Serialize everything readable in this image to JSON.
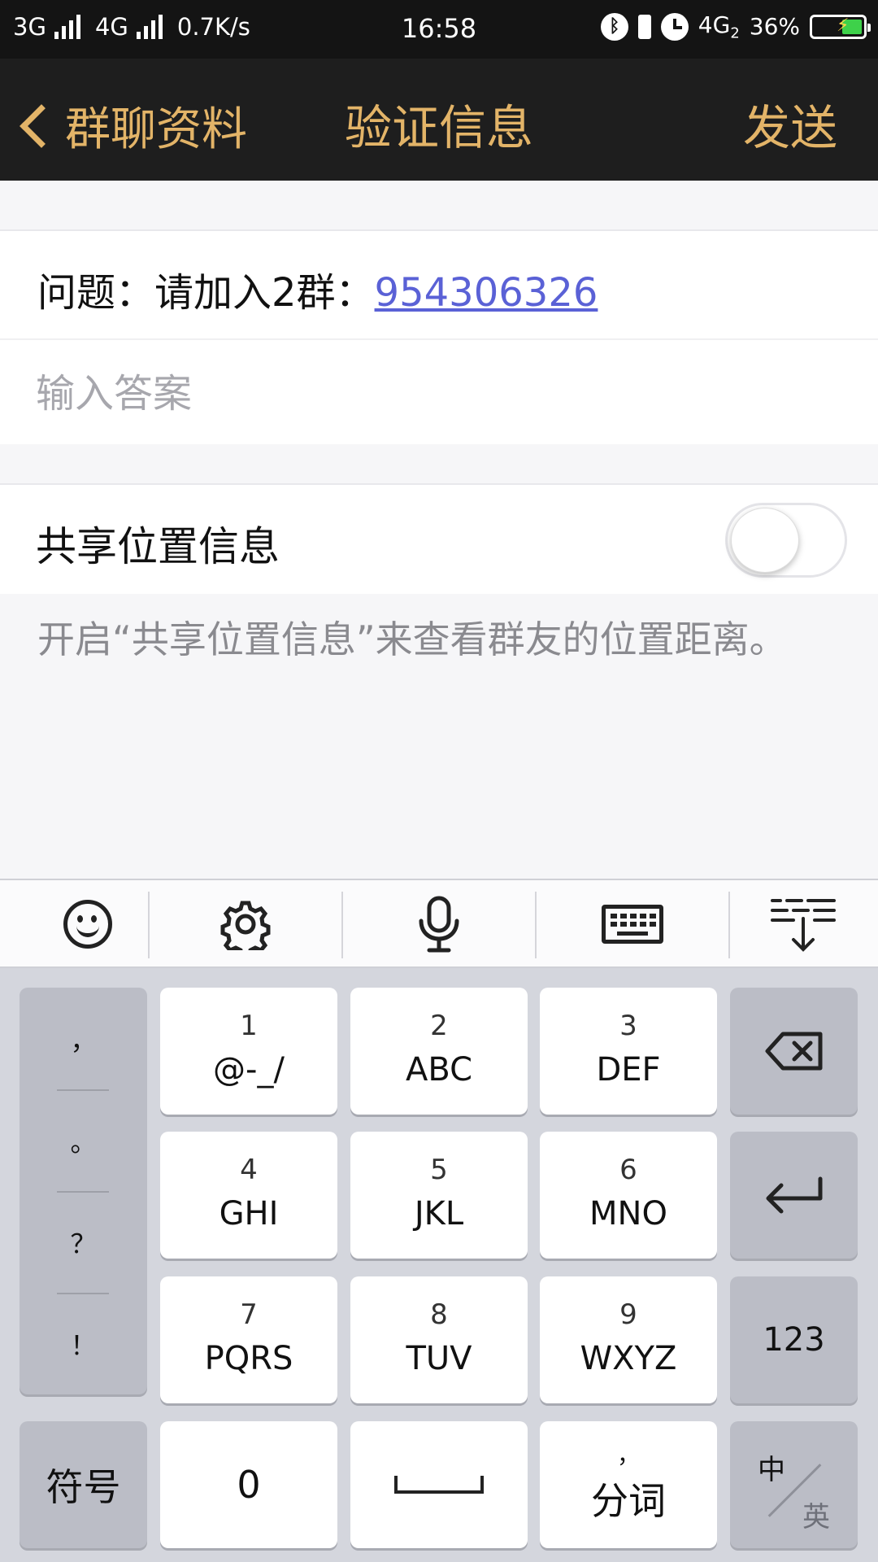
{
  "status_bar": {
    "net1": "3G",
    "net2": "4G",
    "speed": "0.7K/s",
    "time": "16:58",
    "net3": "4G",
    "net3_sub": "2",
    "battery": "36%"
  },
  "nav": {
    "back_label": "群聊资料",
    "title": "验证信息",
    "send_label": "发送"
  },
  "question": {
    "prefix": "问题：请加入2群：",
    "number": "954306326"
  },
  "answer": {
    "placeholder": "输入答案",
    "value": ""
  },
  "location": {
    "label": "共享位置信息",
    "enabled": false,
    "hint": "开启“共享位置信息”来查看群友的位置距离。"
  },
  "keyboard": {
    "toolbar": [
      "emoji-icon",
      "gear-icon",
      "microphone-icon",
      "keyboard-icon",
      "collapse-keyboard-icon"
    ],
    "punctuation": [
      "，",
      "。",
      "？",
      "！"
    ],
    "keys": [
      {
        "digit": "1",
        "letters": "@-_/"
      },
      {
        "digit": "2",
        "letters": "ABC"
      },
      {
        "digit": "3",
        "letters": "DEF"
      },
      {
        "digit": "4",
        "letters": "GHI"
      },
      {
        "digit": "5",
        "letters": "JKL"
      },
      {
        "digit": "6",
        "letters": "MNO"
      },
      {
        "digit": "7",
        "letters": "PQRS"
      },
      {
        "digit": "8",
        "letters": "TUV"
      },
      {
        "digit": "9",
        "letters": "WXYZ"
      }
    ],
    "num_toggle": "123",
    "symbol": "符号",
    "zero": "0",
    "segment_top": "，",
    "segment": "分词",
    "lang_zh": "中",
    "lang_en": "英"
  }
}
